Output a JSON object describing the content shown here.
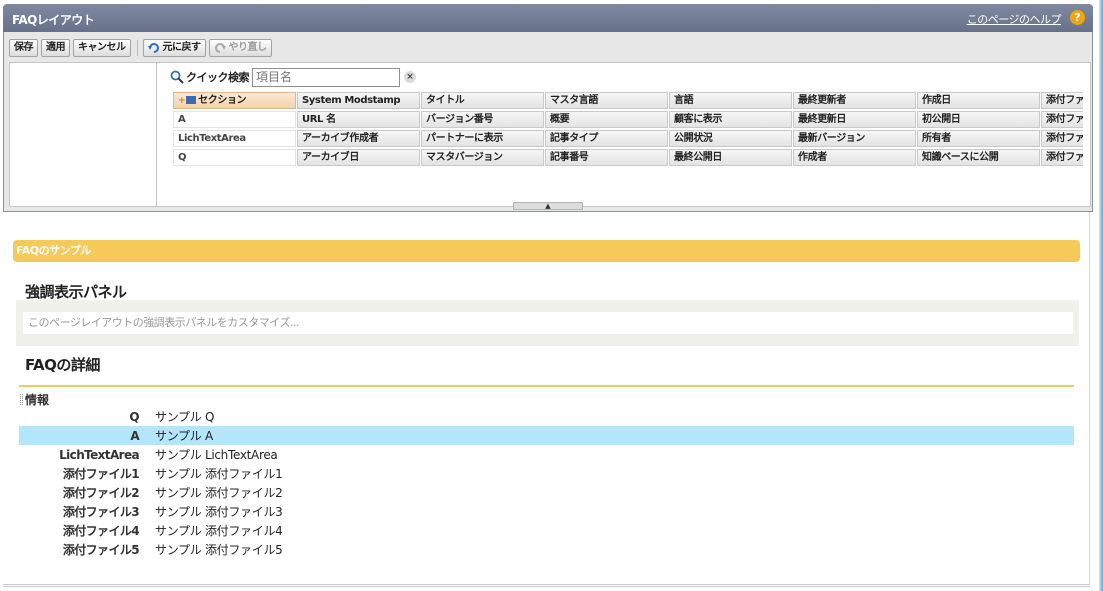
{
  "header": {
    "title": "FAQレイアウト",
    "help_link": "このページのヘルプ",
    "help_icon": "?"
  },
  "toolbar": {
    "save": "保存",
    "apply": "適用",
    "cancel": "キャンセル",
    "undo": "元に戻す",
    "redo": "やり直し"
  },
  "palette": {
    "quick_search_label": "クイック検索",
    "quick_search_placeholder": "項目名",
    "clear_icon": "×",
    "rows": [
      [
        "セクション",
        "System Modstamp",
        "タイトル",
        "マスタ言語",
        "言語",
        "最終更新者",
        "作成日",
        "添付ファイル"
      ],
      [
        "A",
        "URL 名",
        "バージョン番号",
        "概要",
        "顧客に表示",
        "最終更新日",
        "初公開日",
        "添付ファイル"
      ],
      [
        "LichTextArea",
        "アーカイブ作成者",
        "パートナーに表示",
        "記事タイプ",
        "公開状況",
        "最新バージョン",
        "所有者",
        "添付ファイル"
      ],
      [
        "Q",
        "アーカイブ日",
        "マスタバージョン",
        "記事番号",
        "最終公開日",
        "作成者",
        "知識ベースに公開",
        "添付ファイル"
      ]
    ]
  },
  "layout": {
    "sample_bar": "FAQのサンプル",
    "highlights_title": "強調表示パネル",
    "highlights_placeholder": "このページレイアウトの強調表示パネルをカスタマイズ...",
    "detail_title": "FAQの詳細",
    "info_section": "情報",
    "fields": [
      {
        "label": "Q",
        "value": "サンプル Q"
      },
      {
        "label": "A",
        "value": "サンプル A"
      },
      {
        "label": "LichTextArea",
        "value": "サンプル LichTextArea"
      },
      {
        "label": "添付ファイル1",
        "value": "サンプル 添付ファイル1"
      },
      {
        "label": "添付ファイル2",
        "value": "サンプル 添付ファイル2"
      },
      {
        "label": "添付ファイル3",
        "value": "サンプル 添付ファイル3"
      },
      {
        "label": "添付ファイル4",
        "value": "サンプル 添付ファイル4"
      },
      {
        "label": "添付ファイル5",
        "value": "サンプル 添付ファイル5"
      }
    ],
    "selected_index": 1
  },
  "colors": {
    "header_bg": "#6f7a92",
    "section_bar": "#f5c95a",
    "selected_row": "#b3e5fb",
    "help_icon": "#f2a318"
  }
}
